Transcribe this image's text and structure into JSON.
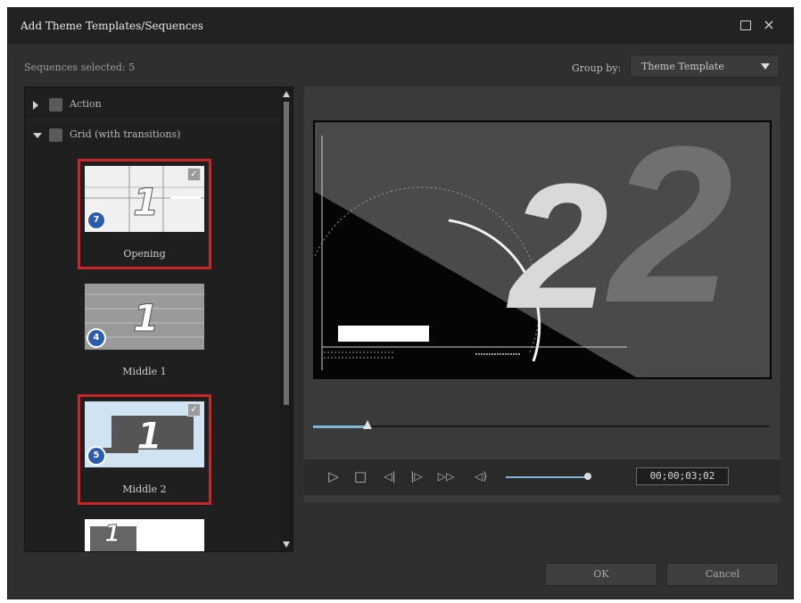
{
  "window": {
    "title": "Add Theme Templates/Sequences",
    "maximize_icon": "maximize-icon",
    "close_icon": "×"
  },
  "header": {
    "sequences_selected": "Sequences selected: 5",
    "group_by_label": "Group by:",
    "group_by_value": "Theme Template"
  },
  "tree": {
    "groups": [
      {
        "label": "Action",
        "expanded": false
      },
      {
        "label": "Grid (with transitions)",
        "expanded": true
      }
    ],
    "items": [
      {
        "label": "Opening",
        "badge": "7",
        "selected": true,
        "checked": true
      },
      {
        "label": "Middle 1",
        "badge": "4",
        "selected": false,
        "checked": false
      },
      {
        "label": "Middle 2",
        "badge": "5",
        "selected": true,
        "checked": true
      },
      {
        "label": "",
        "badge": "",
        "selected": false,
        "checked": false
      }
    ],
    "thumb_glyph": "1"
  },
  "preview": {
    "numerals": "2",
    "seek_progress": 0.12,
    "timecode": "00;00;03;02",
    "volume": 0.95
  },
  "controls": {
    "play_icon": "▷",
    "stop_icon": "□",
    "prev_frame_icon": "◁|",
    "next_frame_icon": "|▷",
    "fast_forward_icon": "▷▷",
    "volume_icon": "◁)"
  },
  "buttons": {
    "ok": "OK",
    "cancel": "Cancel"
  },
  "colors": {
    "selection": "#c8262b",
    "accent": "#7fb6d6",
    "badge": "#2a5cb0"
  }
}
